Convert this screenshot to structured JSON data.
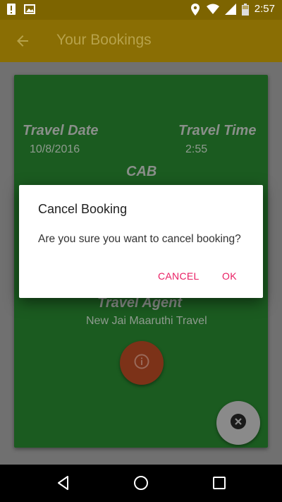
{
  "status_bar": {
    "time": "2:57",
    "icons": [
      "alert-icon",
      "image-icon",
      "location-icon",
      "wifi-icon",
      "signal-icon",
      "battery-icon"
    ]
  },
  "app_bar": {
    "title": "Your Bookings",
    "back_icon": "back-arrow-icon"
  },
  "booking": {
    "travel_date_label": "Travel Date",
    "travel_date": "10/8/2016",
    "travel_time_label": "Travel Time",
    "travel_time": "2:55",
    "vehicle": "CAB",
    "agent_label": "Travel Agent",
    "agent_name": "New Jai Maaruthi Travel"
  },
  "dialog": {
    "title": "Cancel Booking",
    "message": "Are you sure you want to cancel booking?",
    "cancel_label": "CANCEL",
    "ok_label": "OK"
  },
  "fabs": {
    "info_icon": "info-icon",
    "close_icon": "close-icon"
  },
  "nav_bar": {
    "icons": [
      "back-triangle-icon",
      "home-circle-icon",
      "recents-square-icon"
    ]
  },
  "colors": {
    "status_bar": "#7d6400",
    "app_bar": "#8a6e04",
    "card": "#1b5b20",
    "accent": "#e91e63",
    "info_fab": "#7c3218"
  }
}
